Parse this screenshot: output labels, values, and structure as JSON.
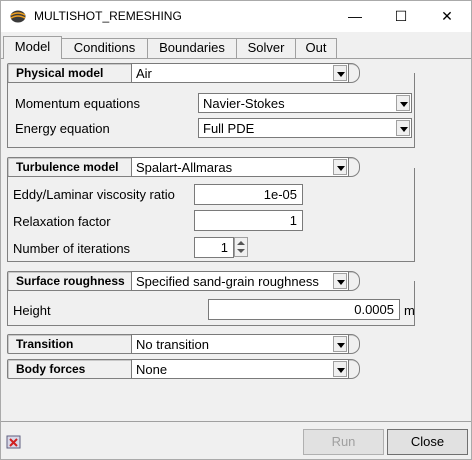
{
  "window": {
    "title": "MULTISHOT_REMESHING",
    "minimize": "—",
    "maximize": "☐",
    "close": "✕"
  },
  "tabs": [
    "Model",
    "Conditions",
    "Boundaries",
    "Solver",
    "Out"
  ],
  "physical_model": {
    "label": "Physical model",
    "value": "Air",
    "momentum_label": "Momentum equations",
    "momentum_value": "Navier-Stokes",
    "energy_label": "Energy equation",
    "energy_value": "Full PDE"
  },
  "turbulence": {
    "label": "Turbulence model",
    "value": "Spalart-Allmaras",
    "eddy_label": "Eddy/Laminar viscosity ratio",
    "eddy_value": "1e-05",
    "relax_label": "Relaxation factor",
    "relax_value": "1",
    "iter_label": "Number of iterations",
    "iter_value": "1"
  },
  "roughness": {
    "label": "Surface roughness",
    "value": "Specified sand-grain roughness",
    "height_label": "Height",
    "height_value": "0.0005",
    "height_unit": "m"
  },
  "transition": {
    "label": "Transition",
    "value": "No transition"
  },
  "body_forces": {
    "label": "Body forces",
    "value": "None"
  },
  "buttons": {
    "run": "Run",
    "close": "Close"
  }
}
